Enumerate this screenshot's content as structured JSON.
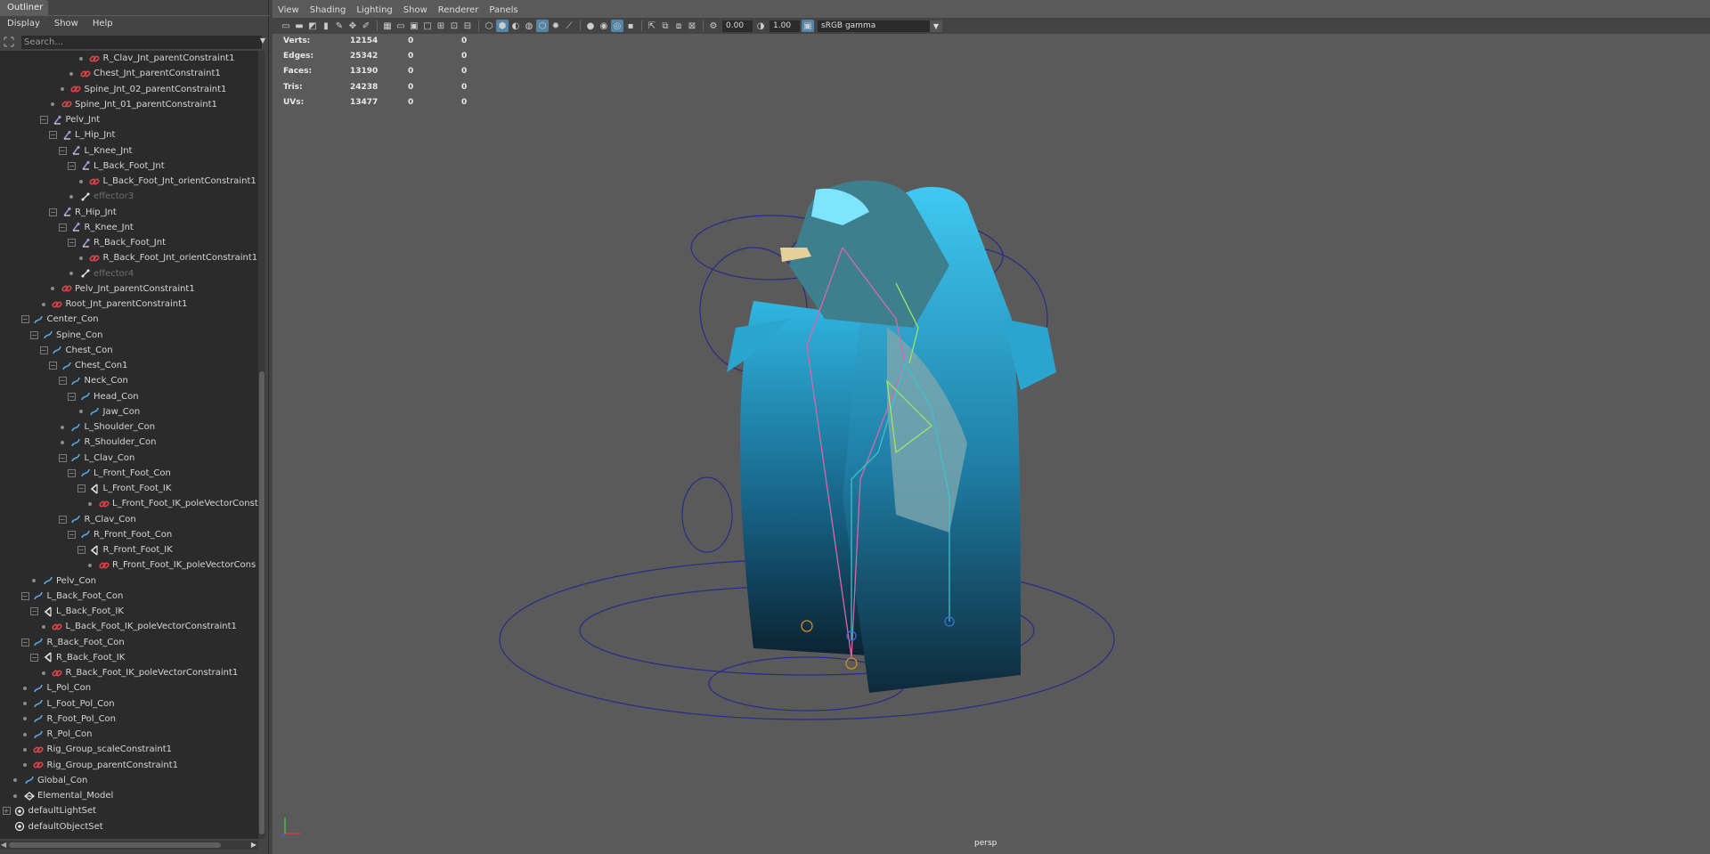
{
  "outliner": {
    "title": "Outliner",
    "menu": [
      "Display",
      "Show",
      "Help"
    ],
    "search_placeholder": "Search...",
    "items": [
      {
        "label": "R_Clav_Jnt_parentConstraint1",
        "icon": "constraint-icon"
      },
      {
        "label": "Chest_Jnt_parentConstraint1",
        "icon": "constraint-icon"
      },
      {
        "label": "Spine_Jnt_02_parentConstraint1",
        "icon": "constraint-icon"
      },
      {
        "label": "Spine_Jnt_01_parentConstraint1",
        "icon": "constraint-icon"
      },
      {
        "label": "Pelv_Jnt",
        "icon": "joint-icon"
      },
      {
        "label": "L_Hip_Jnt",
        "icon": "joint-icon"
      },
      {
        "label": "L_Knee_Jnt",
        "icon": "joint-icon"
      },
      {
        "label": "L_Back_Foot_Jnt",
        "icon": "joint-icon"
      },
      {
        "label": "L_Back_Foot_Jnt_orientConstraint1",
        "icon": "constraint-icon"
      },
      {
        "label": "effector3",
        "icon": "effector-icon"
      },
      {
        "label": "R_Hip_Jnt",
        "icon": "joint-icon"
      },
      {
        "label": "R_Knee_Jnt",
        "icon": "joint-icon"
      },
      {
        "label": "R_Back_Foot_Jnt",
        "icon": "joint-icon"
      },
      {
        "label": "R_Back_Foot_Jnt_orientConstraint1",
        "icon": "constraint-icon"
      },
      {
        "label": "effector4",
        "icon": "effector-icon"
      },
      {
        "label": "Pelv_Jnt_parentConstraint1",
        "icon": "constraint-icon"
      },
      {
        "label": "Root_Jnt_parentConstraint1",
        "icon": "constraint-icon"
      },
      {
        "label": "Center_Con",
        "icon": "curve-icon"
      },
      {
        "label": "Spine_Con",
        "icon": "curve-icon"
      },
      {
        "label": "Chest_Con",
        "icon": "curve-icon"
      },
      {
        "label": "Chest_Con1",
        "icon": "curve-icon"
      },
      {
        "label": "Neck_Con",
        "icon": "curve-icon"
      },
      {
        "label": "Head_Con",
        "icon": "curve-icon"
      },
      {
        "label": "Jaw_Con",
        "icon": "curve-icon"
      },
      {
        "label": "L_Shoulder_Con",
        "icon": "curve-icon"
      },
      {
        "label": "R_Shoulder_Con",
        "icon": "curve-icon"
      },
      {
        "label": "L_Clav_Con",
        "icon": "curve-icon"
      },
      {
        "label": "L_Front_Foot_Con",
        "icon": "curve-icon"
      },
      {
        "label": "L_Front_Foot_IK",
        "icon": "ik-handle-icon"
      },
      {
        "label": "L_Front_Foot_IK_poleVectorConst",
        "icon": "constraint-icon"
      },
      {
        "label": "R_Clav_Con",
        "icon": "curve-icon"
      },
      {
        "label": "R_Front_Foot_Con",
        "icon": "curve-icon"
      },
      {
        "label": "R_Front_Foot_IK",
        "icon": "ik-handle-icon"
      },
      {
        "label": "R_Front_Foot_IK_poleVectorCons",
        "icon": "constraint-icon"
      },
      {
        "label": "Pelv_Con",
        "icon": "curve-icon"
      },
      {
        "label": "L_Back_Foot_Con",
        "icon": "curve-icon"
      },
      {
        "label": "L_Back_Foot_IK",
        "icon": "ik-handle-icon"
      },
      {
        "label": "L_Back_Foot_IK_poleVectorConstraint1",
        "icon": "constraint-icon"
      },
      {
        "label": "R_Back_Foot_Con",
        "icon": "curve-icon"
      },
      {
        "label": "R_Back_Foot_IK",
        "icon": "ik-handle-icon"
      },
      {
        "label": "R_Back_Foot_IK_poleVectorConstraint1",
        "icon": "constraint-icon"
      },
      {
        "label": "L_Pol_Con",
        "icon": "curve-icon"
      },
      {
        "label": "L_Foot_Pol_Con",
        "icon": "curve-icon"
      },
      {
        "label": "R_Foot_Pol_Con",
        "icon": "curve-icon"
      },
      {
        "label": "R_Pol_Con",
        "icon": "curve-icon"
      },
      {
        "label": "Rig_Group_scaleConstraint1",
        "icon": "constraint-icon"
      },
      {
        "label": "Rig_Group_parentConstraint1",
        "icon": "constraint-icon"
      },
      {
        "label": "Global_Con",
        "icon": "curve-icon"
      },
      {
        "label": "Elemental_Model",
        "icon": "mesh-icon"
      },
      {
        "label": "defaultLightSet",
        "icon": "set-icon"
      },
      {
        "label": "defaultObjectSet",
        "icon": "set-icon"
      }
    ]
  },
  "viewport": {
    "menu": [
      "View",
      "Shading",
      "Lighting",
      "Show",
      "Renderer",
      "Panels"
    ],
    "exposure": "0.00",
    "gamma": "1.00",
    "color_space": "sRGB gamma",
    "camera_label": "persp",
    "hud": [
      {
        "label": "Verts:",
        "value": "12154",
        "sel": "0",
        "comp": "0"
      },
      {
        "label": "Edges:",
        "value": "25342",
        "sel": "0",
        "comp": "0"
      },
      {
        "label": "Faces:",
        "value": "13190",
        "sel": "0",
        "comp": "0"
      },
      {
        "label": "Tris:",
        "value": "24238",
        "sel": "0",
        "comp": "0"
      },
      {
        "label": "UVs:",
        "value": "13477",
        "sel": "0",
        "comp": "0"
      }
    ]
  },
  "colors": {
    "accent": "#5285a6",
    "panel": "#444444",
    "tree_bg": "#2b2b2b",
    "viewport_bg": "#5a5a5a",
    "constraint": "#d9434a",
    "joint": "#a88fd8",
    "curve": "#5aa8e0"
  }
}
